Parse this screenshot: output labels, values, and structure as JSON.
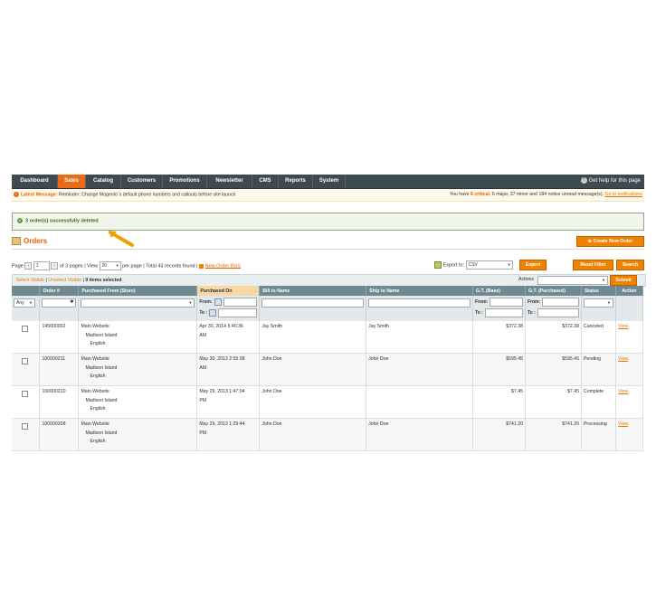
{
  "nav": {
    "items": [
      "Dashboard",
      "Sales",
      "Catalog",
      "Customers",
      "Promotions",
      "Newsletter",
      "CMS",
      "Reports",
      "System"
    ],
    "active": "Sales",
    "help": "Get help for this page"
  },
  "notice": {
    "label": "Latest Message:",
    "text": "Reminder: Change Magento`s default phone numbers and callouts before site launch",
    "right_prefix": "You have",
    "critical": "6 critical",
    "rest": ", 6 major, 37 minor and 184 notice unread message(s).",
    "link": "Go to notifications"
  },
  "success": {
    "text": "3 order(s) successfully deleted"
  },
  "page": {
    "title": "Orders",
    "create_button": "Create New Order"
  },
  "pager": {
    "page_label": "Page",
    "page_value": "1",
    "of_pages": "of 3 pages",
    "view_label": "View",
    "view_value": "20",
    "per_page": "per page",
    "total": "Total 43 records found",
    "rss": "New Order RSS",
    "export_label": "Export to:",
    "export_value": "CSV",
    "export_button": "Export",
    "reset_button": "Reset Filter",
    "search_button": "Search"
  },
  "mass": {
    "select_visible": "Select Visible",
    "unselect_visible": "Unselect Visible",
    "selected": "0 items selected",
    "actions_label": "Actions",
    "submit": "Submit"
  },
  "columns": [
    "Order #",
    "Purchased From (Store)",
    "Purchased On",
    "Bill to Name",
    "Ship to Name",
    "G.T. (Base)",
    "G.T. (Purchased)",
    "Status",
    "Action"
  ],
  "filter": {
    "any": "Any",
    "from": "From:",
    "to": "To :"
  },
  "rows": [
    {
      "order": "145000002",
      "store1": "Main Website",
      "store2": "Madison Island",
      "store3": "English",
      "date1": "Apr 30, 2014 5:40:36",
      "date2": "AM",
      "bill": "Jay Smith",
      "ship": "Jay Smith",
      "base": "$372.38",
      "purchased": "$372.38",
      "status": "Canceled",
      "action": "View"
    },
    {
      "order": "100000211",
      "store1": "Main Website",
      "store2": "Madison Island",
      "store3": "English",
      "date1": "May 30, 2013 2:55:38",
      "date2": "AM",
      "bill": "John Doe",
      "ship": "John Doe",
      "base": "$595.45",
      "purchased": "$595.45",
      "status": "Pending",
      "action": "View"
    },
    {
      "order": "100000210",
      "store1": "Main Website",
      "store2": "Madison Island",
      "store3": "English",
      "date1": "May 29, 2013 1:47:04",
      "date2": "PM",
      "bill": "John Doe",
      "ship": "",
      "base": "$7.45",
      "purchased": "$7.45",
      "status": "Complete",
      "action": "View"
    },
    {
      "order": "100000208",
      "store1": "Main Website",
      "store2": "Madison Island",
      "store3": "English",
      "date1": "May 29, 2013 1:29:44",
      "date2": "PM",
      "bill": "John Doe",
      "ship": "John Doe",
      "base": "$741.20",
      "purchased": "$741.20",
      "status": "Processing",
      "action": "View"
    }
  ]
}
